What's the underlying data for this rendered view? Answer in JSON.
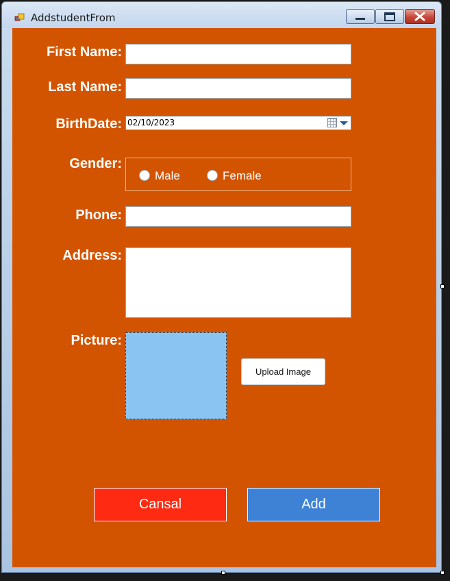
{
  "window": {
    "title": "AddstudentFrom"
  },
  "form": {
    "first_name_label": "First Name:",
    "last_name_label": "Last Name:",
    "birthdate_label": "BirthDate:",
    "birthdate_value": "02/10/2023",
    "gender_label": "Gender:",
    "gender_options": [
      "Male",
      "Female"
    ],
    "phone_label": "Phone:",
    "address_label": "Address:",
    "picture_label": "Picture:",
    "upload_button": "Upload Image",
    "cancel_button": "Cansal",
    "add_button": "Add"
  },
  "colors": {
    "form_background": "#d35400",
    "cancel_button": "#ff2a12",
    "add_button": "#3e82d6",
    "picture_box": "#8ac4f2"
  }
}
